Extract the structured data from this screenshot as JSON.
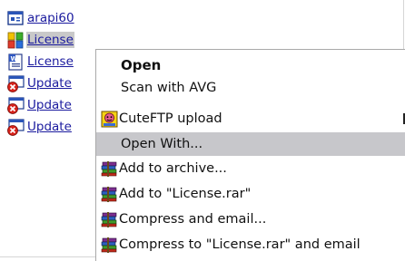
{
  "files": [
    {
      "name": "arapi60",
      "icon": "app-window-icon"
    },
    {
      "name": "License",
      "icon": "multicolor-document-icon",
      "selected": true
    },
    {
      "name": "License",
      "icon": "word-document-icon"
    },
    {
      "name": "Update",
      "icon": "executable-error-icon"
    },
    {
      "name": "Update",
      "icon": "executable-error-icon"
    },
    {
      "name": "Update",
      "icon": "executable-error-icon"
    }
  ],
  "context_menu": {
    "items": [
      {
        "label": "Open",
        "bold": true
      },
      {
        "label": "Scan with AVG"
      },
      {
        "label": "CuteFTP upload",
        "icon": "cuteftp-icon",
        "has_submenu": true
      },
      {
        "label": "Open With...",
        "highlighted": true
      },
      {
        "label": "Add to archive...",
        "icon": "winrar-books-icon"
      },
      {
        "label": "Add to \"License.rar\"",
        "icon": "winrar-books-icon"
      },
      {
        "label": "Compress and email...",
        "icon": "winrar-books-icon"
      },
      {
        "label": "Compress to \"License.rar\" and email",
        "icon": "winrar-books-icon"
      }
    ]
  },
  "colors": {
    "link_text": "#1a1a9e",
    "highlight": "#c7c7cb",
    "selection": "#c9c9c9"
  }
}
